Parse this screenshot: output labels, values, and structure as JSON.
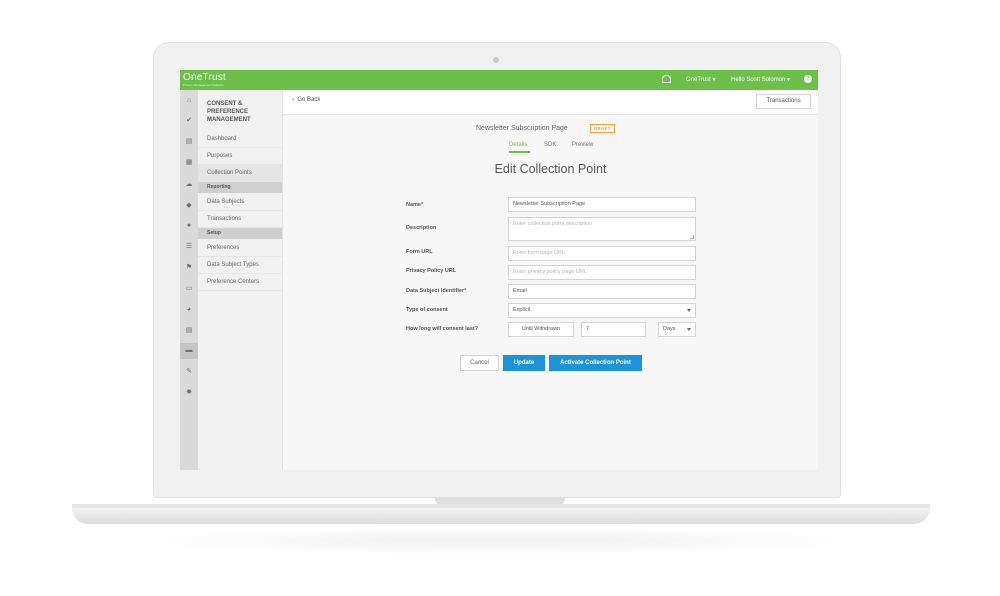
{
  "colors": {
    "brand": "#6cc04a",
    "primary_button": "#1e93d6",
    "draft_badge": "#f0a63c",
    "required": "#d9362b"
  },
  "topbar": {
    "logo": "OneTrust",
    "logo_sub": "Privacy Management Software",
    "org_menu": "OneTrust ▾",
    "user_menu": "Hello Scott Solomon ▾",
    "help": "?"
  },
  "rail_icons": [
    "home-icon",
    "check-icon",
    "document-icon",
    "grid-icon",
    "cloud-icon",
    "tag-icon",
    "globe-icon",
    "list-icon",
    "flag-icon",
    "folder-icon",
    "chart-icon",
    "card-icon",
    "wrench-icon",
    "gear-icon"
  ],
  "subnav": {
    "title": "CONSENT & PREFERENCE MANAGEMENT",
    "items": [
      {
        "label": "Dashboard"
      },
      {
        "label": "Purposes"
      },
      {
        "label": "Collection Points"
      }
    ],
    "reporting_header": "Reporting",
    "reporting_items": [
      {
        "label": "Data Subjects"
      },
      {
        "label": "Transactions"
      }
    ],
    "setup_header": "Setup",
    "setup_items": [
      {
        "label": "Preferences"
      },
      {
        "label": "Data Subject Types"
      },
      {
        "label": "Preference Centers"
      }
    ]
  },
  "header": {
    "back": "Go Back",
    "transactions": "Transactions"
  },
  "page": {
    "name": "Newsletter Subscription Page",
    "badge": "DRAFT",
    "tabs": [
      {
        "label": "Details"
      },
      {
        "label": "SDK"
      },
      {
        "label": "Preview"
      }
    ],
    "heading": "Edit Collection Point"
  },
  "form": {
    "name_label": "Name",
    "name_value": "Newsletter Subscription Page",
    "description_label": "Description",
    "description_placeholder": "Enter collection point description",
    "form_url_label": "Form URL",
    "form_url_placeholder": "Enter form page URL",
    "privacy_url_label": "Privacy Policy URL",
    "privacy_url_placeholder": "Enter privacy policy page URL",
    "identifier_label": "Data Subject Identifier",
    "identifier_value": "Email",
    "consent_type_label": "Type of consent",
    "consent_type_value": "Explicit",
    "duration_label": "How long will consent last?",
    "duration_button": "Until Withdrawn",
    "duration_value": "7",
    "duration_unit": "Days",
    "required_mark": "*"
  },
  "actions": {
    "cancel": "Cancel",
    "update": "Update",
    "activate": "Activate Collection Point"
  }
}
